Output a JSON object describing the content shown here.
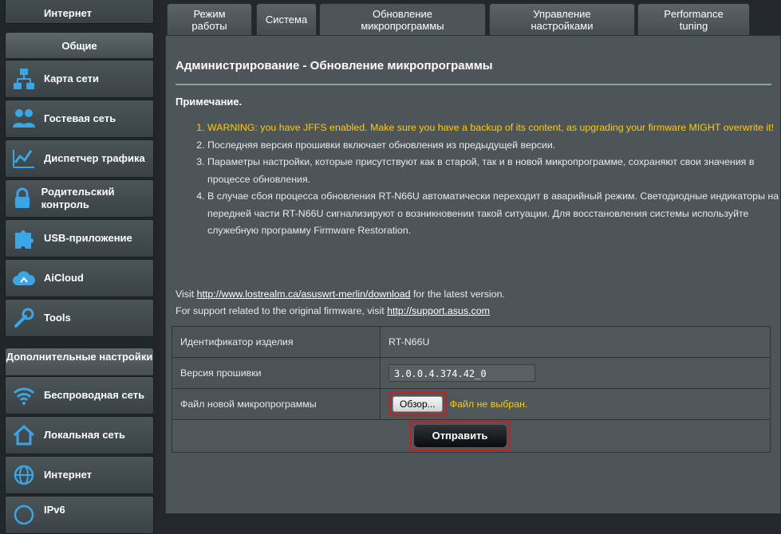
{
  "sidebar": {
    "top_item": "Интернет",
    "general_header": "Общие",
    "general": [
      {
        "label": "Карта сети",
        "icon": "network-map-icon"
      },
      {
        "label": "Гостевая сеть",
        "icon": "guest-network-icon"
      },
      {
        "label": "Диспетчер трафика",
        "icon": "traffic-manager-icon"
      },
      {
        "label": "Родительский контроль",
        "icon": "parental-control-icon"
      },
      {
        "label": "USB-приложение",
        "icon": "usb-puzzle-icon"
      },
      {
        "label": "AiCloud",
        "icon": "aicloud-icon"
      },
      {
        "label": "Tools",
        "icon": "wrench-icon"
      }
    ],
    "advanced_header": "Дополнительные настройки",
    "advanced": [
      {
        "label": "Беспроводная сеть",
        "icon": "wifi-icon"
      },
      {
        "label": "Локальная сеть",
        "icon": "home-icon"
      },
      {
        "label": "Интернет",
        "icon": "globe-icon"
      },
      {
        "label": "IPv6",
        "icon": "ipv6-icon"
      }
    ]
  },
  "tabs": [
    {
      "label": "Режим работы"
    },
    {
      "label": "Система"
    },
    {
      "label": "Обновление микропрограммы"
    },
    {
      "label": "Управление настройками"
    },
    {
      "label": "Performance tuning"
    }
  ],
  "page": {
    "title": "Администрирование - Обновление микропрограммы",
    "note_label": "Примечание.",
    "notes": [
      "WARNING: you have JFFS enabled. Make sure you have a backup of its content, as upgrading your firmware MIGHT overwrite it!",
      "Последняя версия прошивки включает обновления из предыдущей версии.",
      "Параметры настройки, которые присутствуют как в старой, так и в новой микропрограмме, сохраняют свои значения в процессе обновления.",
      "В случае сбоя процесса обновления RT-N66U автоматически переходит в аварийный режим. Светодиодные индикаторы на передней части RT-N66U сигнализируют о возникновении такой ситуации. Для восстановления системы используйте служебную программу Firmware Restoration."
    ],
    "visit_prefix": "Visit ",
    "visit_link": "http://www.lostrealm.ca/asuswrt-merlin/download",
    "visit_suffix": " for the latest version.",
    "support_prefix": "For support related to the original firmware, visit ",
    "support_link": "http://support.asus.com"
  },
  "form": {
    "product_id_label": "Идентификатор изделия",
    "product_id_value": "RT-N66U",
    "fw_version_label": "Версия прошивки",
    "fw_version_value": "3.0.0.4.374.42_0",
    "new_fw_label": "Файл новой микропрограммы",
    "browse_label": "Обзор...",
    "no_file_text": "Файл не выбран.",
    "submit_label": "Отправить"
  },
  "colors": {
    "warning": "#ffcc00",
    "highlight_border": "#c81e1e",
    "panel": "#4d5558"
  }
}
